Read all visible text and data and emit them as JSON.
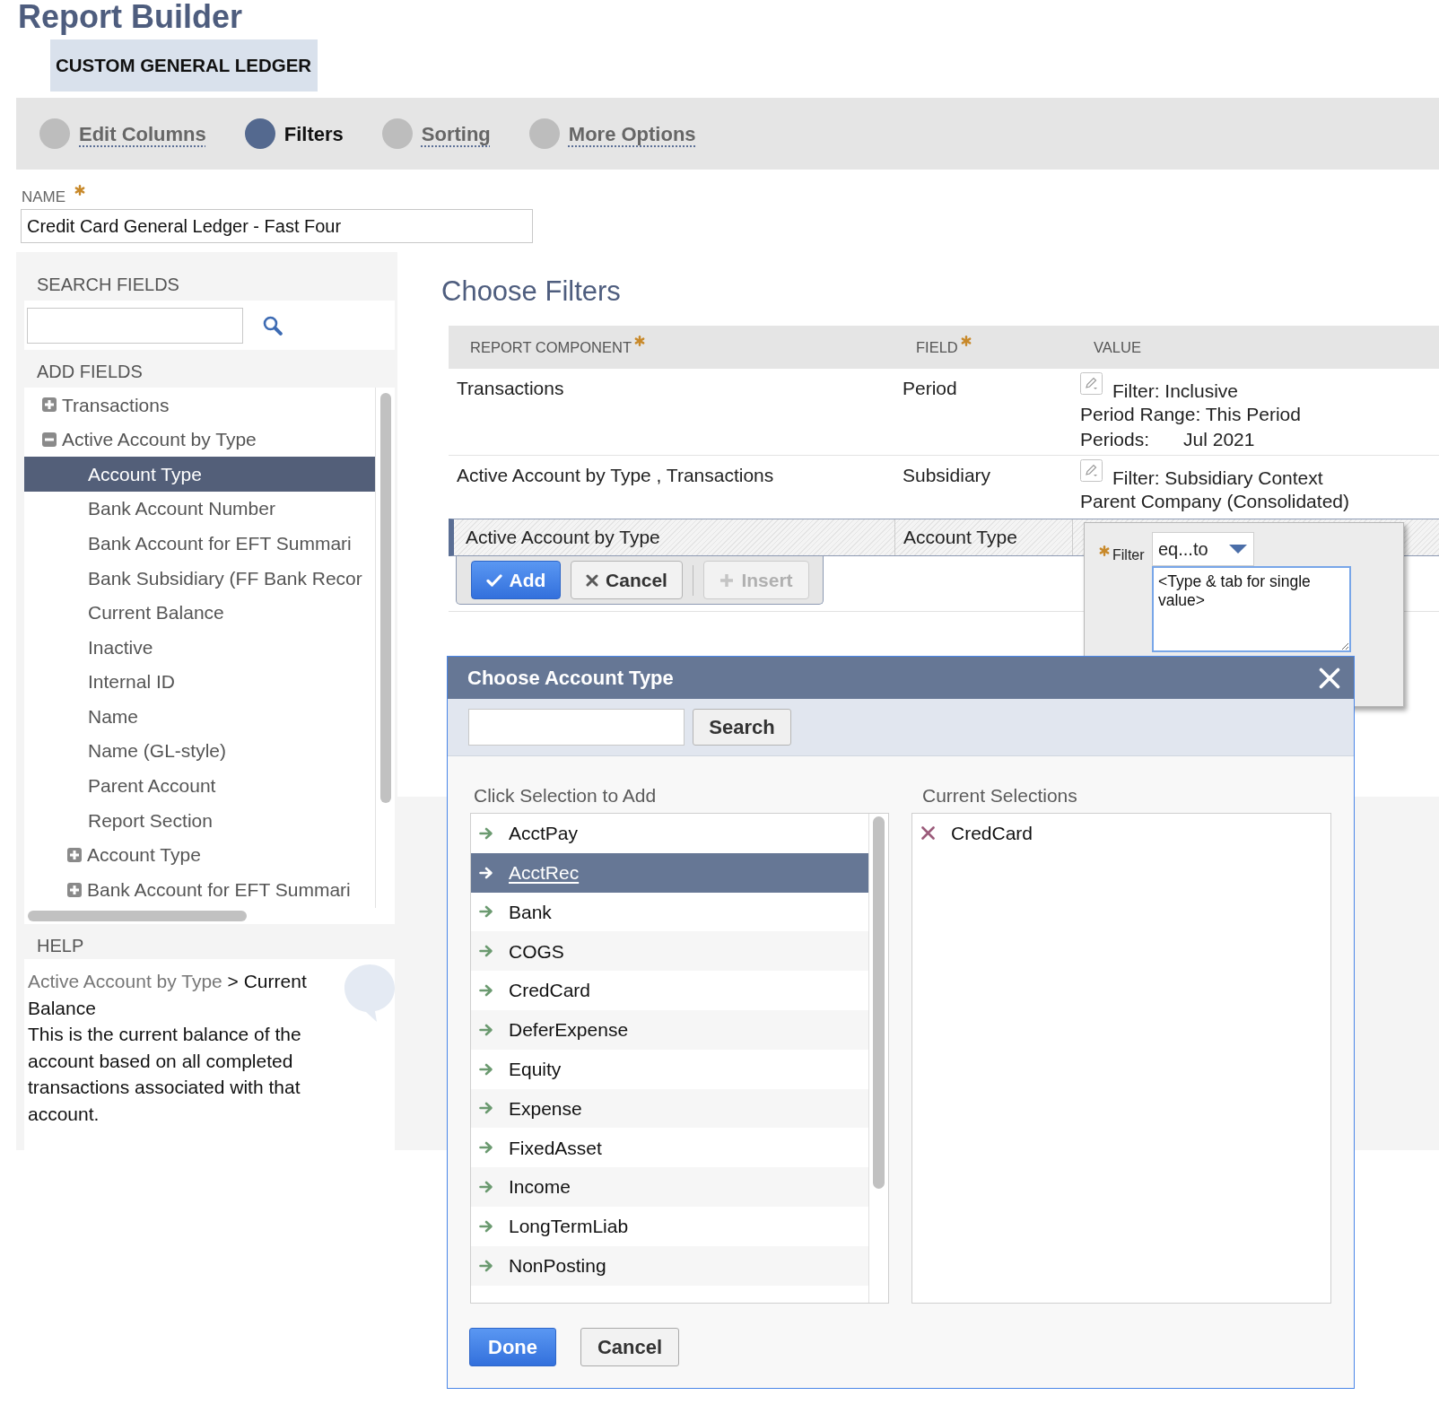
{
  "header": {
    "title": "Report Builder",
    "report_type": "CUSTOM GENERAL LEDGER"
  },
  "steps": [
    {
      "label": "Edit Columns",
      "selected": false
    },
    {
      "label": "Filters",
      "selected": true
    },
    {
      "label": "Sorting",
      "selected": false
    },
    {
      "label": "More Options",
      "selected": false
    }
  ],
  "name_field": {
    "label": "NAME",
    "required": true,
    "value": "Credit Card General Ledger - Fast Four"
  },
  "sidebar": {
    "search_heading": "SEARCH FIELDS",
    "add_heading": "ADD FIELDS",
    "tree": [
      {
        "kind": "group",
        "label": "Transactions",
        "expanded": false,
        "selected": false
      },
      {
        "kind": "group",
        "label": "Active Account by Type",
        "expanded": true,
        "selected": false,
        "children": [
          {
            "kind": "field",
            "label": "Account Type",
            "selected": true
          },
          {
            "kind": "field",
            "label": "Bank Account Number",
            "selected": false
          },
          {
            "kind": "field",
            "label": "Bank Account for EFT Summari",
            "selected": false
          },
          {
            "kind": "field",
            "label": "Bank Subsidiary (FF Bank Recor",
            "selected": false
          },
          {
            "kind": "field",
            "label": "Current Balance",
            "selected": false
          },
          {
            "kind": "field",
            "label": "Inactive",
            "selected": false
          },
          {
            "kind": "field",
            "label": "Internal ID",
            "selected": false
          },
          {
            "kind": "field",
            "label": "Name",
            "selected": false
          },
          {
            "kind": "field",
            "label": "Name (GL-style)",
            "selected": false
          },
          {
            "kind": "field",
            "label": "Parent Account",
            "selected": false
          },
          {
            "kind": "field",
            "label": "Report Section",
            "selected": false
          },
          {
            "kind": "group",
            "label": "Account Type",
            "expanded": false,
            "selected": false
          },
          {
            "kind": "group",
            "label": "Bank Account for EFT Summari",
            "expanded": false,
            "selected": false
          }
        ]
      }
    ],
    "help": {
      "heading": "HELP",
      "path": "Active Account by Type",
      "topic": "> Current Balance",
      "text": "This is the current balance of the account based on all completed transactions associated with that account."
    }
  },
  "filters": {
    "title": "Choose Filters",
    "columns": [
      {
        "label": "REPORT COMPONENT",
        "required": true
      },
      {
        "label": "FIELD",
        "required": true
      },
      {
        "label": "VALUE"
      }
    ],
    "rows": [
      {
        "component": "Transactions",
        "field": "Period",
        "editing": false,
        "value": [
          {
            "text": "Filter: Inclusive"
          },
          {
            "text": "Period Range: This Period"
          },
          {
            "text": "Periods:",
            "value": "Jul 2021"
          }
        ]
      },
      {
        "component": "Active Account by Type , Transactions",
        "field": "Subsidiary",
        "editing": false,
        "value": [
          {
            "text": "Filter: Subsidiary Context"
          },
          {
            "text": "Parent Company (Consolidated)"
          }
        ]
      },
      {
        "component": "Active Account by Type",
        "field": "Account Type",
        "editing": true
      }
    ],
    "edit_buttons": [
      {
        "label": "Add",
        "kind": "confirm",
        "disabled": false
      },
      {
        "label": "Cancel",
        "kind": "cancel",
        "disabled": false
      },
      {
        "label": "Insert",
        "kind": "insert",
        "disabled": true
      }
    ],
    "filter_popup": {
      "label": "Filter",
      "required": true,
      "operator": "eq...to",
      "placeholder": "<Type & tab for single value>"
    }
  },
  "dialog": {
    "title": "Choose Account Type",
    "search_button": "Search",
    "available_heading": "Click Selection to Add",
    "available": [
      {
        "label": "AcctPay",
        "selected": false
      },
      {
        "label": "AcctRec",
        "selected": true
      },
      {
        "label": "Bank",
        "selected": false
      },
      {
        "label": "COGS",
        "selected": false
      },
      {
        "label": "CredCard",
        "selected": false
      },
      {
        "label": "DeferExpense",
        "selected": false
      },
      {
        "label": "Equity",
        "selected": false
      },
      {
        "label": "Expense",
        "selected": false
      },
      {
        "label": "FixedAsset",
        "selected": false
      },
      {
        "label": "Income",
        "selected": false
      },
      {
        "label": "LongTermLiab",
        "selected": false
      },
      {
        "label": "NonPosting",
        "selected": false
      }
    ],
    "current_heading": "Current Selections",
    "current": [
      {
        "label": "CredCard"
      }
    ],
    "buttons": [
      {
        "label": "Done",
        "kind": "primary"
      },
      {
        "label": "Cancel",
        "kind": "secondary"
      }
    ]
  }
}
